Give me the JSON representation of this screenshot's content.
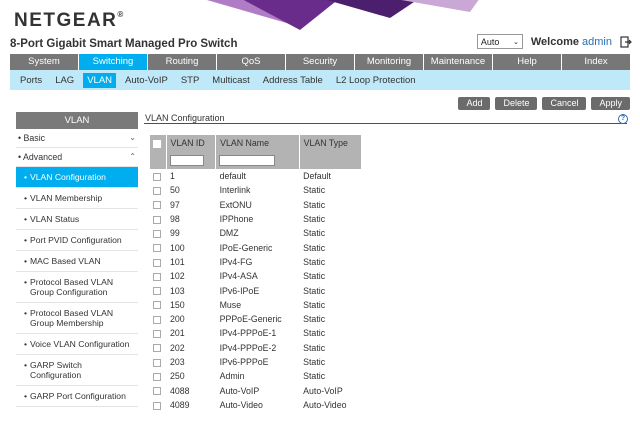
{
  "header": {
    "logo_text": "NETGEAR",
    "logo_tm": "®",
    "product": "8-Port Gigabit Smart Managed Pro Switch",
    "lang_value": "Auto",
    "welcome_label": "Welcome",
    "user": "admin"
  },
  "topnav": [
    "System",
    "Switching",
    "Routing",
    "QoS",
    "Security",
    "Monitoring",
    "Maintenance",
    "Help",
    "Index"
  ],
  "topnav_active": "Switching",
  "subnav": [
    "Ports",
    "LAG",
    "VLAN",
    "Auto-VoIP",
    "STP",
    "Multicast",
    "Address Table",
    "L2 Loop Protection"
  ],
  "subnav_active": "VLAN",
  "actions": {
    "add": "Add",
    "delete": "Delete",
    "cancel": "Cancel",
    "apply": "Apply"
  },
  "sidebar": {
    "title": "VLAN",
    "basic": "Basic",
    "advanced": "Advanced",
    "items": [
      "VLAN Configuration",
      "VLAN Membership",
      "VLAN Status",
      "Port PVID Configuration",
      "MAC Based VLAN",
      "Protocol Based VLAN Group Configuration",
      "Protocol Based VLAN Group Membership",
      "Voice VLAN Configuration",
      "GARP Switch Configuration",
      "GARP Port Configuration"
    ]
  },
  "main": {
    "title": "VLAN Configuration",
    "help": "?",
    "columns": {
      "id": "VLAN ID",
      "name": "VLAN Name",
      "type": "VLAN Type"
    },
    "rows": [
      [
        "1",
        "default",
        "Default"
      ],
      [
        "50",
        "Interlink",
        "Static"
      ],
      [
        "97",
        "ExtONU",
        "Static"
      ],
      [
        "98",
        "IPPhone",
        "Static"
      ],
      [
        "99",
        "DMZ",
        "Static"
      ],
      [
        "100",
        "IPoE-Generic",
        "Static"
      ],
      [
        "101",
        "IPv4-FG",
        "Static"
      ],
      [
        "102",
        "IPv4-ASA",
        "Static"
      ],
      [
        "103",
        "IPv6-IPoE",
        "Static"
      ],
      [
        "150",
        "Muse",
        "Static"
      ],
      [
        "200",
        "PPPoE-Generic",
        "Static"
      ],
      [
        "201",
        "IPv4-PPPoE-1",
        "Static"
      ],
      [
        "202",
        "IPv4-PPPoE-2",
        "Static"
      ],
      [
        "203",
        "IPv6-PPPoE",
        "Static"
      ],
      [
        "250",
        "Admin",
        "Static"
      ],
      [
        "4088",
        "Auto-VoIP",
        "Auto-VoIP"
      ],
      [
        "4089",
        "Auto-Video",
        "Auto-Video"
      ]
    ]
  }
}
